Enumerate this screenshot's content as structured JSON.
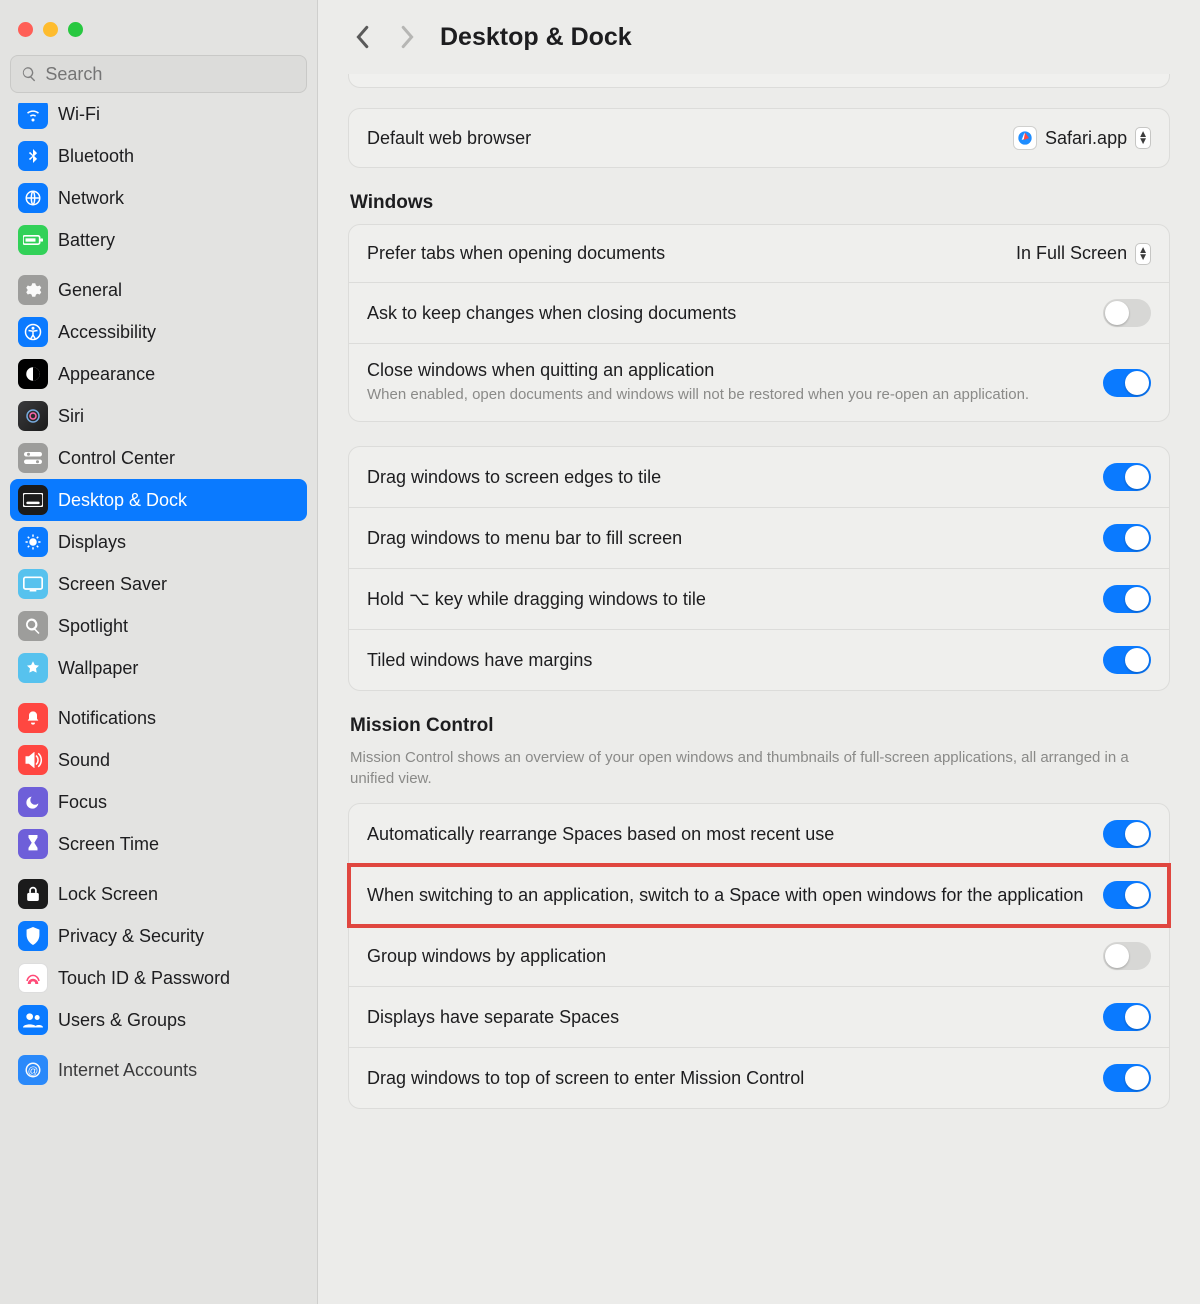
{
  "search": {
    "placeholder": "Search"
  },
  "header": {
    "title": "Desktop & Dock"
  },
  "sidebar": {
    "items": [
      {
        "label": "Wi-Fi",
        "icon": "wifi-icon",
        "color": "#0a7aff"
      },
      {
        "label": "Bluetooth",
        "icon": "bluetooth-icon",
        "color": "#0a7aff"
      },
      {
        "label": "Network",
        "icon": "network-icon",
        "color": "#0a7aff"
      },
      {
        "label": "Battery",
        "icon": "battery-icon",
        "color": "#32d158"
      },
      {
        "label": "General",
        "icon": "general-icon",
        "color": "#9d9d9b"
      },
      {
        "label": "Accessibility",
        "icon": "accessibility-icon",
        "color": "#0a7aff"
      },
      {
        "label": "Appearance",
        "icon": "appearance-icon",
        "color": "#000000"
      },
      {
        "label": "Siri",
        "icon": "siri-icon",
        "color": "#1b1b1b"
      },
      {
        "label": "Control Center",
        "icon": "control-center-icon",
        "color": "#9d9d9b"
      },
      {
        "label": "Desktop & Dock",
        "icon": "dock-icon",
        "color": "#1b1b1b"
      },
      {
        "label": "Displays",
        "icon": "displays-icon",
        "color": "#0a7aff"
      },
      {
        "label": "Screen Saver",
        "icon": "screensaver-icon",
        "color": "#57c2ee"
      },
      {
        "label": "Spotlight",
        "icon": "spotlight-icon",
        "color": "#9d9d9b"
      },
      {
        "label": "Wallpaper",
        "icon": "wallpaper-icon",
        "color": "#57c2ee"
      },
      {
        "label": "Notifications",
        "icon": "notifications-icon",
        "color": "#ff4741"
      },
      {
        "label": "Sound",
        "icon": "sound-icon",
        "color": "#ff4741"
      },
      {
        "label": "Focus",
        "icon": "focus-icon",
        "color": "#6e5fd9"
      },
      {
        "label": "Screen Time",
        "icon": "screentime-icon",
        "color": "#6e5fd9"
      },
      {
        "label": "Lock Screen",
        "icon": "lock-icon",
        "color": "#1b1b1b"
      },
      {
        "label": "Privacy & Security",
        "icon": "privacy-icon",
        "color": "#0a7aff"
      },
      {
        "label": "Touch ID & Password",
        "icon": "touchid-icon",
        "color": "#ffffff"
      },
      {
        "label": "Users & Groups",
        "icon": "users-icon",
        "color": "#0a7aff"
      },
      {
        "label": "Internet Accounts",
        "icon": "internet-accounts-icon",
        "color": "#0a7aff"
      }
    ],
    "selected_index": 9
  },
  "browser_card": {
    "label": "Default web browser",
    "value": "Safari.app"
  },
  "windows_section": {
    "title": "Windows",
    "prefer_tabs": {
      "label": "Prefer tabs when opening documents",
      "value": "In Full Screen"
    },
    "ask_keep": {
      "label": "Ask to keep changes when closing documents",
      "on": false
    },
    "close_quit": {
      "label": "Close windows when quitting an application",
      "desc": "When enabled, open documents and windows will not be restored when you re-open an application.",
      "on": true
    }
  },
  "tiling_section": {
    "edge_tile": {
      "label": "Drag windows to screen edges to tile",
      "on": true
    },
    "menubar_fill": {
      "label": "Drag windows to menu bar to fill screen",
      "on": true
    },
    "hold_option": {
      "label": "Hold ⌥ key while dragging windows to tile",
      "on": true
    },
    "margins": {
      "label": "Tiled windows have margins",
      "on": true
    }
  },
  "mission_control": {
    "title": "Mission Control",
    "desc": "Mission Control shows an overview of your open windows and thumbnails of full-screen applications, all arranged in a unified view.",
    "auto_rearrange": {
      "label": "Automatically rearrange Spaces based on most recent use",
      "on": true
    },
    "switch_space": {
      "label": "When switching to an application, switch to a Space with open windows for the application",
      "on": true
    },
    "group_by_app": {
      "label": "Group windows by application",
      "on": false
    },
    "separate_spaces": {
      "label": "Displays have separate Spaces",
      "on": true
    },
    "drag_top": {
      "label": "Drag windows to top of screen to enter Mission Control",
      "on": true
    }
  }
}
